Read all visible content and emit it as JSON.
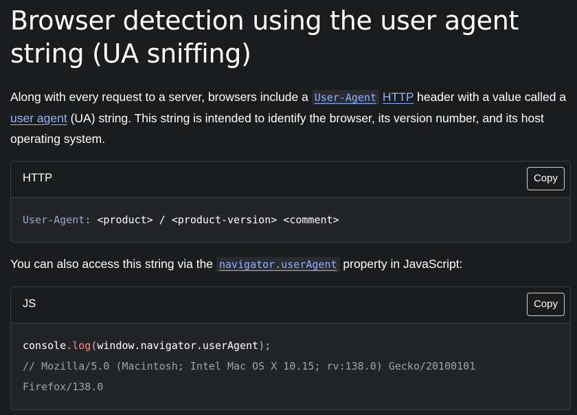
{
  "title": "Browser detection using the user agent string (UA sniffing)",
  "para1": {
    "t1": "Along with every request to a server, browsers include a ",
    "code1": "User-Agent",
    "link_http": "HTTP",
    "t2": " header with a value called a ",
    "link_ua": "user agent",
    "t3": " (UA) string. This string is intended to identify the browser, its version number, and its host operating system."
  },
  "http_block": {
    "language": "HTTP",
    "copy_label": "Copy",
    "attr": "User-Agent",
    "colon": ":",
    "rest": " <product> / <product-version> <comment>"
  },
  "para2": {
    "t1": "You can also access this string via the ",
    "code1": "navigator.userAgent",
    "t2": " property in JavaScript:"
  },
  "js_block": {
    "language": "JS",
    "copy_label": "Copy",
    "obj": "console",
    "dot": ".",
    "fn": "log",
    "open": "(",
    "args": "window.navigator.userAgent",
    "close": ");",
    "comment_line1": "// Mozilla/5.0 (Macintosh; Intel Mac OS X 10.15; rv:138.0) Gecko/20100101",
    "comment_line2": "Firefox/138.0"
  }
}
